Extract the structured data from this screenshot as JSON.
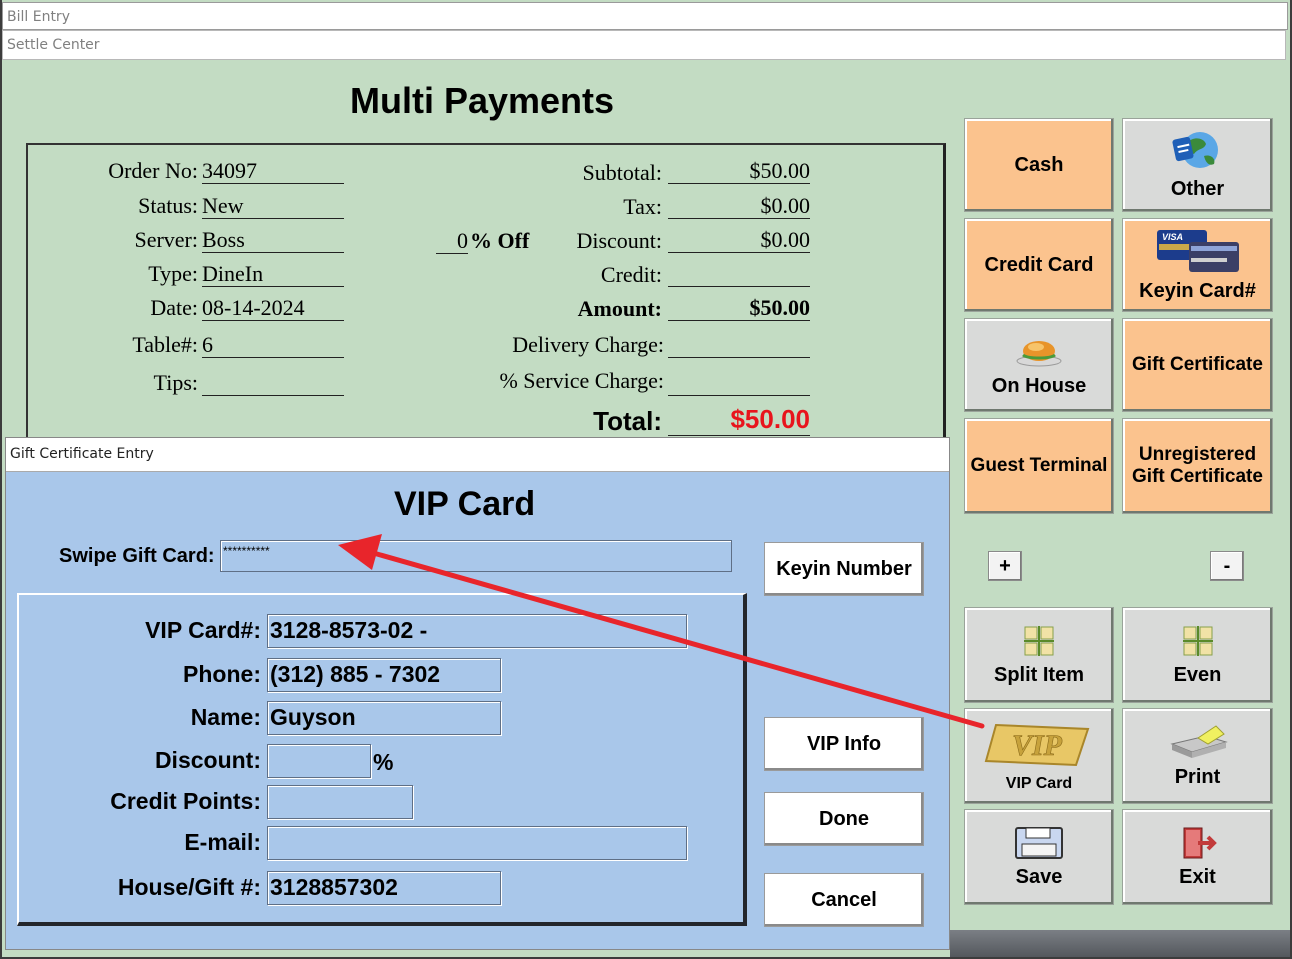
{
  "window": {
    "title": "Bill Entry",
    "subtitle": "Settle Center"
  },
  "page_title": "Multi Payments",
  "order": {
    "order_no_label": "Order No:",
    "order_no": "34097",
    "status_label": "Status:",
    "status": "New",
    "server_label": "Server:",
    "server": "Boss",
    "type_label": "Type:",
    "type": "DineIn",
    "date_label": "Date:",
    "date": "08-14-2024",
    "table_label": "Table#:",
    "table": "6",
    "tips_label": "Tips:",
    "tips": "",
    "pct_value": "0",
    "pct_off_label": "% Off"
  },
  "totals": {
    "subtotal_label": "Subtotal:",
    "subtotal": "$50.00",
    "tax_label": "Tax:",
    "tax": "$0.00",
    "discount_label": "Discount:",
    "discount": "$0.00",
    "credit_label": "Credit:",
    "credit": "",
    "amount_label": "Amount:",
    "amount": "$50.00",
    "delivery_label": "Delivery Charge:",
    "delivery": "",
    "service_label": "% Service Charge:",
    "service": "",
    "total_label": "Total:",
    "total": "$50.00",
    "total_color": "#e8141c"
  },
  "payment_buttons": {
    "cash": "Cash",
    "other": "Other",
    "credit_card": "Credit Card",
    "keyin_card": "Keyin Card#",
    "on_house": "On House",
    "gift_certificate": "Gift Certificate",
    "guest_terminal": "Guest Terminal",
    "unregistered_gift": "Unregistered Gift Certificate",
    "plus": "+",
    "minus": "-",
    "split_item": "Split Item",
    "even": "Even",
    "vip_card": "VIP Card",
    "print": "Print",
    "save": "Save",
    "exit": "Exit"
  },
  "dialog": {
    "titlebar": "Gift Certificate  Entry",
    "title": "VIP Card",
    "swipe_label": "Swipe Gift Card:",
    "swipe_value": "**********",
    "keyin_number": "Keyin Number",
    "vip_info": "VIP Info",
    "done": "Done",
    "cancel": "Cancel",
    "fields": {
      "vip_card_label": "VIP Card#:",
      "vip_card": "3128-8573-02  -",
      "phone_label": "Phone:",
      "phone": "(312) 885 - 7302",
      "name_label": "Name:",
      "name": "Guyson",
      "discount_label": "Discount:",
      "discount": "",
      "discount_unit": "%",
      "credit_points_label": "Credit Points:",
      "credit_points": "",
      "email_label": "E-mail:",
      "email": "",
      "house_gift_label": "House/Gift #:",
      "house_gift": "3128857302"
    }
  },
  "annotation": {
    "arrow_color": "#e8252b"
  }
}
